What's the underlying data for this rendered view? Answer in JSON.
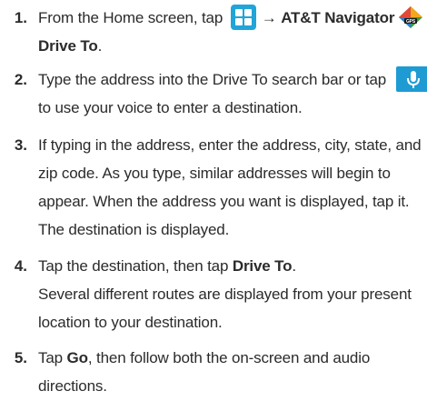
{
  "steps": [
    {
      "number": "1.",
      "text_a": "From the Home screen, tap ",
      "arrow_1": "→",
      "app_name": "AT&T Navigator",
      "arrow_2": "→",
      "target": "Drive To",
      "tail": "."
    },
    {
      "number": "2.",
      "text_a": "Type the address into the Drive To search bar or tap ",
      "text_b": "to use your voice to enter a destination."
    },
    {
      "number": "3.",
      "lines": [
        "If typing in the address, enter the address, city, state, and",
        "zip code. As you type, similar addresses will begin to",
        "appear. When the address you want is displayed, tap it."
      ],
      "note": "The destination is displayed."
    },
    {
      "number": "4.",
      "text_a": "Tap the destination, then tap ",
      "target": "Drive To",
      "tail": ".",
      "note_lines": [
        "Several different routes are displayed from your present",
        "location to your destination."
      ]
    },
    {
      "number": "5.",
      "text_a": "Tap ",
      "target": "Go",
      "text_b": ", then follow both the on-screen and audio",
      "text_c": "directions."
    }
  ],
  "icons": {
    "apps": "apps-grid-icon",
    "navigator": "att-navigator-gps-icon",
    "voice": "microphone-icon",
    "accent_color": "#21a5d8"
  }
}
